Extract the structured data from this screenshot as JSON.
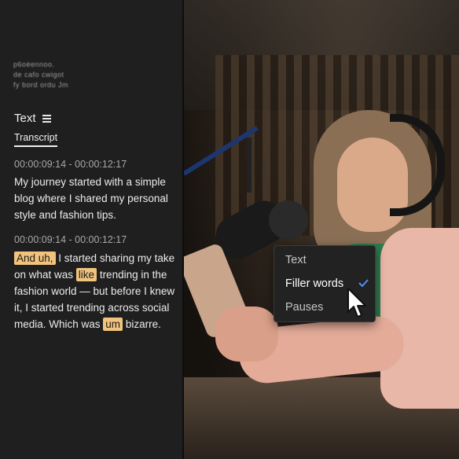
{
  "sidebar": {
    "blurred_lines": [
      "p6oéennoo.",
      "de cafo cwigot",
      "fy bord ordu Jm"
    ],
    "title": "Text",
    "tab": "Transcript",
    "blocks": [
      {
        "timestamp": "00:00:09:14 - 00:00:12:17",
        "text": "My journey started with a simple blog where I shared my personal style and fashion tips."
      },
      {
        "timestamp": "00:00:09:14 - 00:00:12:17",
        "segments": [
          {
            "t": "And uh,",
            "h": true
          },
          {
            "t": " I started sharing my take on what was ",
            "h": false
          },
          {
            "t": "like",
            "h": true
          },
          {
            "t": " trending in the fashion world — but before I knew it, I started trending across social media. Which was ",
            "h": false
          },
          {
            "t": "um",
            "h": true
          },
          {
            "t": " bizarre.",
            "h": false
          }
        ]
      }
    ]
  },
  "dropdown": {
    "items": [
      "Text",
      "Filler words",
      "Pauses"
    ],
    "selected_index": 1
  },
  "colors": {
    "highlight": "#f1c37c",
    "check": "#4f8ef7",
    "panel_bg": "#1f1f1f"
  },
  "icons": [
    "menu-icon",
    "checkmark-icon",
    "mouse-cursor-icon"
  ]
}
